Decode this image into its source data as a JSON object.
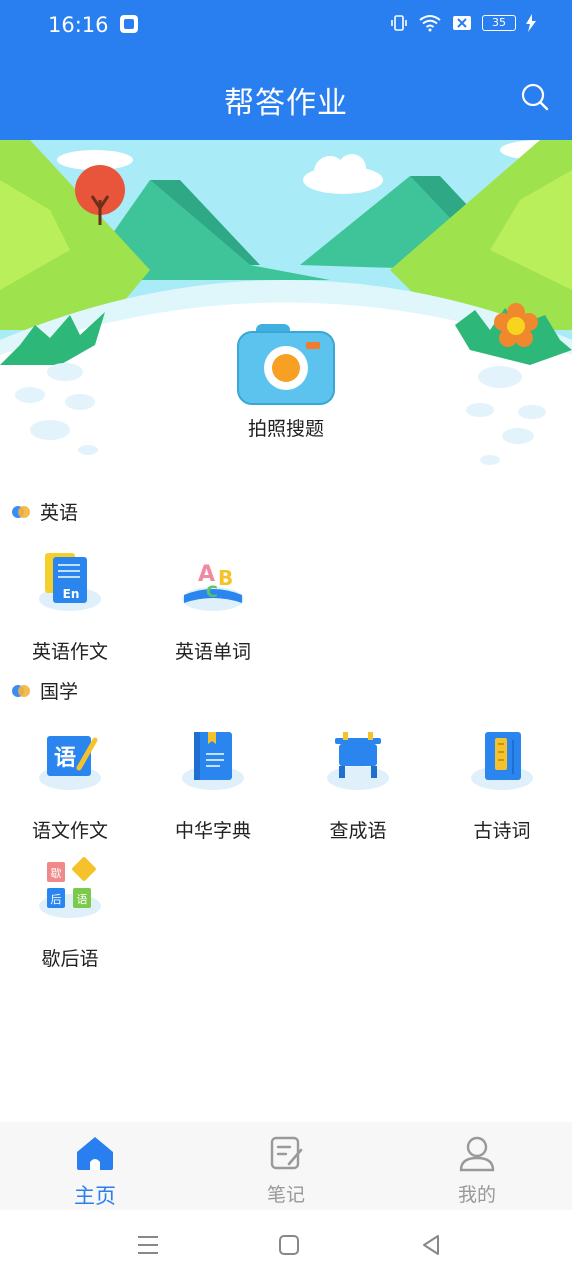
{
  "status_bar": {
    "time": "16:16",
    "battery": "35"
  },
  "header": {
    "title": "帮答作业"
  },
  "banner": {
    "camera_label": "拍照搜题"
  },
  "sections": [
    {
      "title": "英语",
      "items": [
        "英语作文",
        "英语单词"
      ]
    },
    {
      "title": "国学",
      "items": [
        "语文作文",
        "中华字典",
        "查成语",
        "古诗词",
        "歇后语"
      ]
    }
  ],
  "tabbar": {
    "items": [
      "主页",
      "笔记",
      "我的"
    ],
    "active": "主页"
  },
  "colors": {
    "primary": "#2a7ff0",
    "text": "#222222",
    "muted": "#999999"
  },
  "icons": [
    "search-icon",
    "camera-icon",
    "english-essay-icon",
    "english-words-icon",
    "chinese-essay-icon",
    "dictionary-icon",
    "idiom-icon",
    "poetry-icon",
    "xiehouyu-icon",
    "home-icon",
    "notes-icon",
    "profile-icon"
  ]
}
